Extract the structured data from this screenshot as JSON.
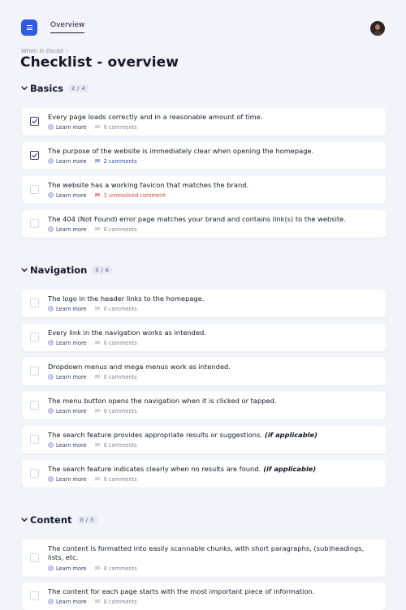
{
  "header": {
    "tab_label": "Overview"
  },
  "breadcrumb": {
    "parent": "When in Doubt",
    "separator": "›"
  },
  "page": {
    "title": "Checklist - overview"
  },
  "colors": {
    "accent": "#2f5bdc",
    "comment_count_active": "#2c4ea8",
    "unresolved": "#d8433b"
  },
  "icons": {
    "menu": "menu-icon",
    "chevron": "chevron-down-icon",
    "check": "check-icon",
    "info": "info-icon",
    "comment": "comment-icon"
  },
  "sections": [
    {
      "title": "Basics",
      "count": "2 / 4",
      "items": [
        {
          "text": "Every page loads correctly and in a reasonable amount of time.",
          "note": "",
          "checked": true,
          "learn": "Learn more",
          "comments": "0 comments",
          "comment_style": ""
        },
        {
          "text": "The purpose of the website is immediately clear when opening the homepage.",
          "note": "",
          "checked": true,
          "learn": "Learn more",
          "comments": "2 comments",
          "comment_style": "blue"
        },
        {
          "text": "The website has a working favicon that matches the brand.",
          "note": "",
          "checked": false,
          "learn": "Learn more",
          "comments": "1 unresolved comment",
          "comment_style": "red"
        },
        {
          "text": "The 404 (Not Found) error page matches your brand and contains link(s) to the website.",
          "note": "",
          "checked": false,
          "learn": "Learn more",
          "comments": "0 comments",
          "comment_style": ""
        }
      ]
    },
    {
      "title": "Navigation",
      "count": "0 / 6",
      "items": [
        {
          "text": "The logo in the header links to the homepage.",
          "note": "",
          "checked": false,
          "learn": "Learn more",
          "comments": "0 comments",
          "comment_style": ""
        },
        {
          "text": "Every link in the navigation works as intended.",
          "note": "",
          "checked": false,
          "learn": "Learn more",
          "comments": "0 comments",
          "comment_style": ""
        },
        {
          "text": "Dropdown menus and mega menus work as intended.",
          "note": "",
          "checked": false,
          "learn": "Learn more",
          "comments": "0 comments",
          "comment_style": ""
        },
        {
          "text": "The menu button opens the navigation when it is clicked or tapped.",
          "note": "",
          "checked": false,
          "learn": "Learn more",
          "comments": "0 comments",
          "comment_style": ""
        },
        {
          "text": "The search feature provides appropriate results or suggestions.",
          "note": "(if applicable)",
          "checked": false,
          "learn": "Learn more",
          "comments": "0 comments",
          "comment_style": ""
        },
        {
          "text": "The search feature indicates clearly when no results are found.",
          "note": "(if applicable)",
          "checked": false,
          "learn": "Learn more",
          "comments": "0 comments",
          "comment_style": ""
        }
      ]
    },
    {
      "title": "Content",
      "count": "0 / 3",
      "items": [
        {
          "text": "The content is formatted into easily scannable chunks, with short paragraphs, (sub)headings, lists, etc.",
          "note": "",
          "checked": false,
          "learn": "Learn more",
          "comments": "0 comments",
          "comment_style": ""
        },
        {
          "text": "The content for each page starts with the most important piece of information.",
          "note": "",
          "checked": false,
          "learn": "Learn more",
          "comments": "0 comments",
          "comment_style": ""
        }
      ]
    }
  ]
}
